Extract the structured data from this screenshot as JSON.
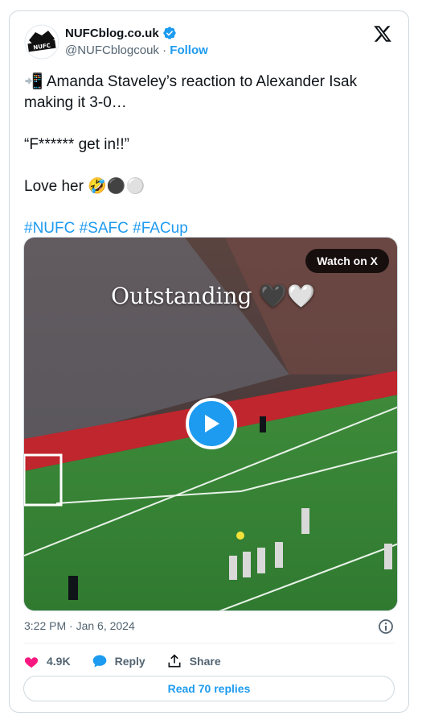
{
  "tweet": {
    "display_name": "NUFCblog.co.uk",
    "handle": "@NUFCblogcouk",
    "separator": "·",
    "follow_label": "Follow",
    "line1": "📲 Amanda Staveley’s reaction to Alexander Isak making it 3-0…",
    "line2": "“F****** get in!!”",
    "line3": "Love her 🤣⚫⚪",
    "hashtags": "#NUFC #SAFC #FACup",
    "timestamp": "3:22 PM · Jan 6, 2024"
  },
  "media": {
    "watch_label": "Watch on X",
    "overlay_text": "Outstanding 🖤🤍"
  },
  "actions": {
    "likes": "4.9K",
    "reply_label": "Reply",
    "share_label": "Share",
    "read_replies_label": "Read 70 replies"
  },
  "colors": {
    "accent": "#1d9bf0",
    "like": "#f91880",
    "muted": "#536471"
  }
}
